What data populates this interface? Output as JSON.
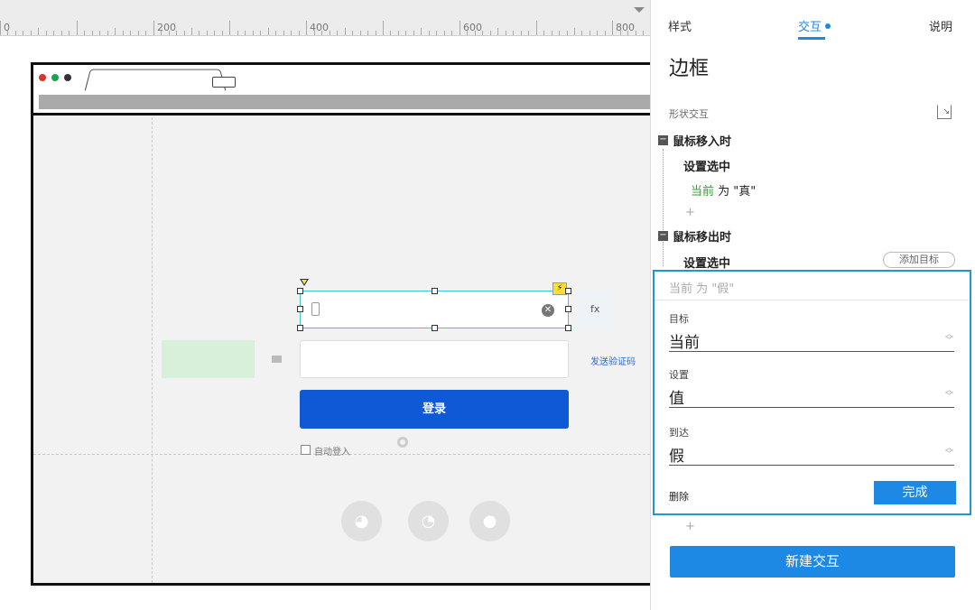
{
  "ruler": {
    "labels": [
      "0",
      "200",
      "400",
      "600",
      "800"
    ]
  },
  "canvas": {
    "login_button": "登录",
    "send_code_link": "发送验证码",
    "fx_label": "fx",
    "auto_login_label": "自动登入",
    "social_icons": [
      "wechat-icon",
      "weibo-icon",
      "qq-icon"
    ]
  },
  "panel": {
    "tabs": [
      "样式",
      "交互",
      "说明"
    ],
    "active_tab": "交互",
    "title": "边框",
    "section_label": "形状交互",
    "events": [
      {
        "name": "鼠标移入时",
        "action": "设置选中",
        "detail_prefix": "当前",
        "detail_suffix": " 为 \"真\""
      },
      {
        "name": "鼠标移出时",
        "action": "设置选中"
      }
    ],
    "add_target": "添加目标",
    "add_plus": "+",
    "editor": {
      "summary": "当前 为 \"假\"",
      "fields": [
        {
          "label": "目标",
          "value": "当前"
        },
        {
          "label": "设置",
          "value": "值"
        },
        {
          "label": "到达",
          "value": "假"
        }
      ],
      "delete": "删除",
      "done": "完成"
    },
    "new_interaction": "新建交互"
  },
  "colors": {
    "accent": "#1e88e5",
    "login_button": "#0f59d6",
    "selection": "#3cc6d0"
  }
}
